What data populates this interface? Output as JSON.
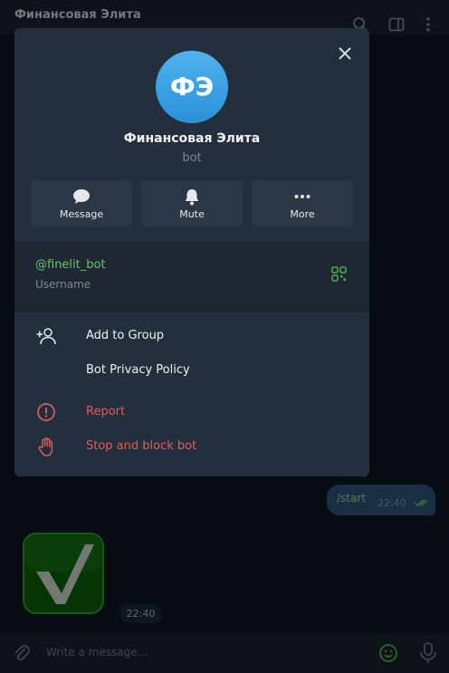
{
  "header": {
    "title": "Финансовая Элита"
  },
  "chat": {
    "outgoing": {
      "text": "/start",
      "time": "22:40"
    },
    "incoming": {
      "emoji": "✔",
      "time": "22:40"
    }
  },
  "input": {
    "placeholder": "Write a message..."
  },
  "modal": {
    "avatar_initials": "ФЭ",
    "name": "Финансовая Элита",
    "subtitle": "bot",
    "actions": [
      {
        "label": "Message",
        "icon": "chat-bubble-icon"
      },
      {
        "label": "Mute",
        "icon": "bell-icon"
      },
      {
        "label": "More",
        "icon": "more-dots-icon"
      }
    ],
    "username": "@finelit_bot",
    "username_label": "Username",
    "menu": [
      {
        "label": "Add to Group",
        "icon": "add-user-icon"
      },
      {
        "label": "Bot Privacy Policy",
        "icon": ""
      },
      {
        "label": "Report",
        "icon": "report-icon"
      },
      {
        "label": "Stop and block bot",
        "icon": "hand-stop-icon"
      }
    ]
  },
  "colors": {
    "accent": "#2a91d9",
    "link": "#6bc26a",
    "danger": "#e05c5c",
    "bubble_out": "#2b5278"
  }
}
